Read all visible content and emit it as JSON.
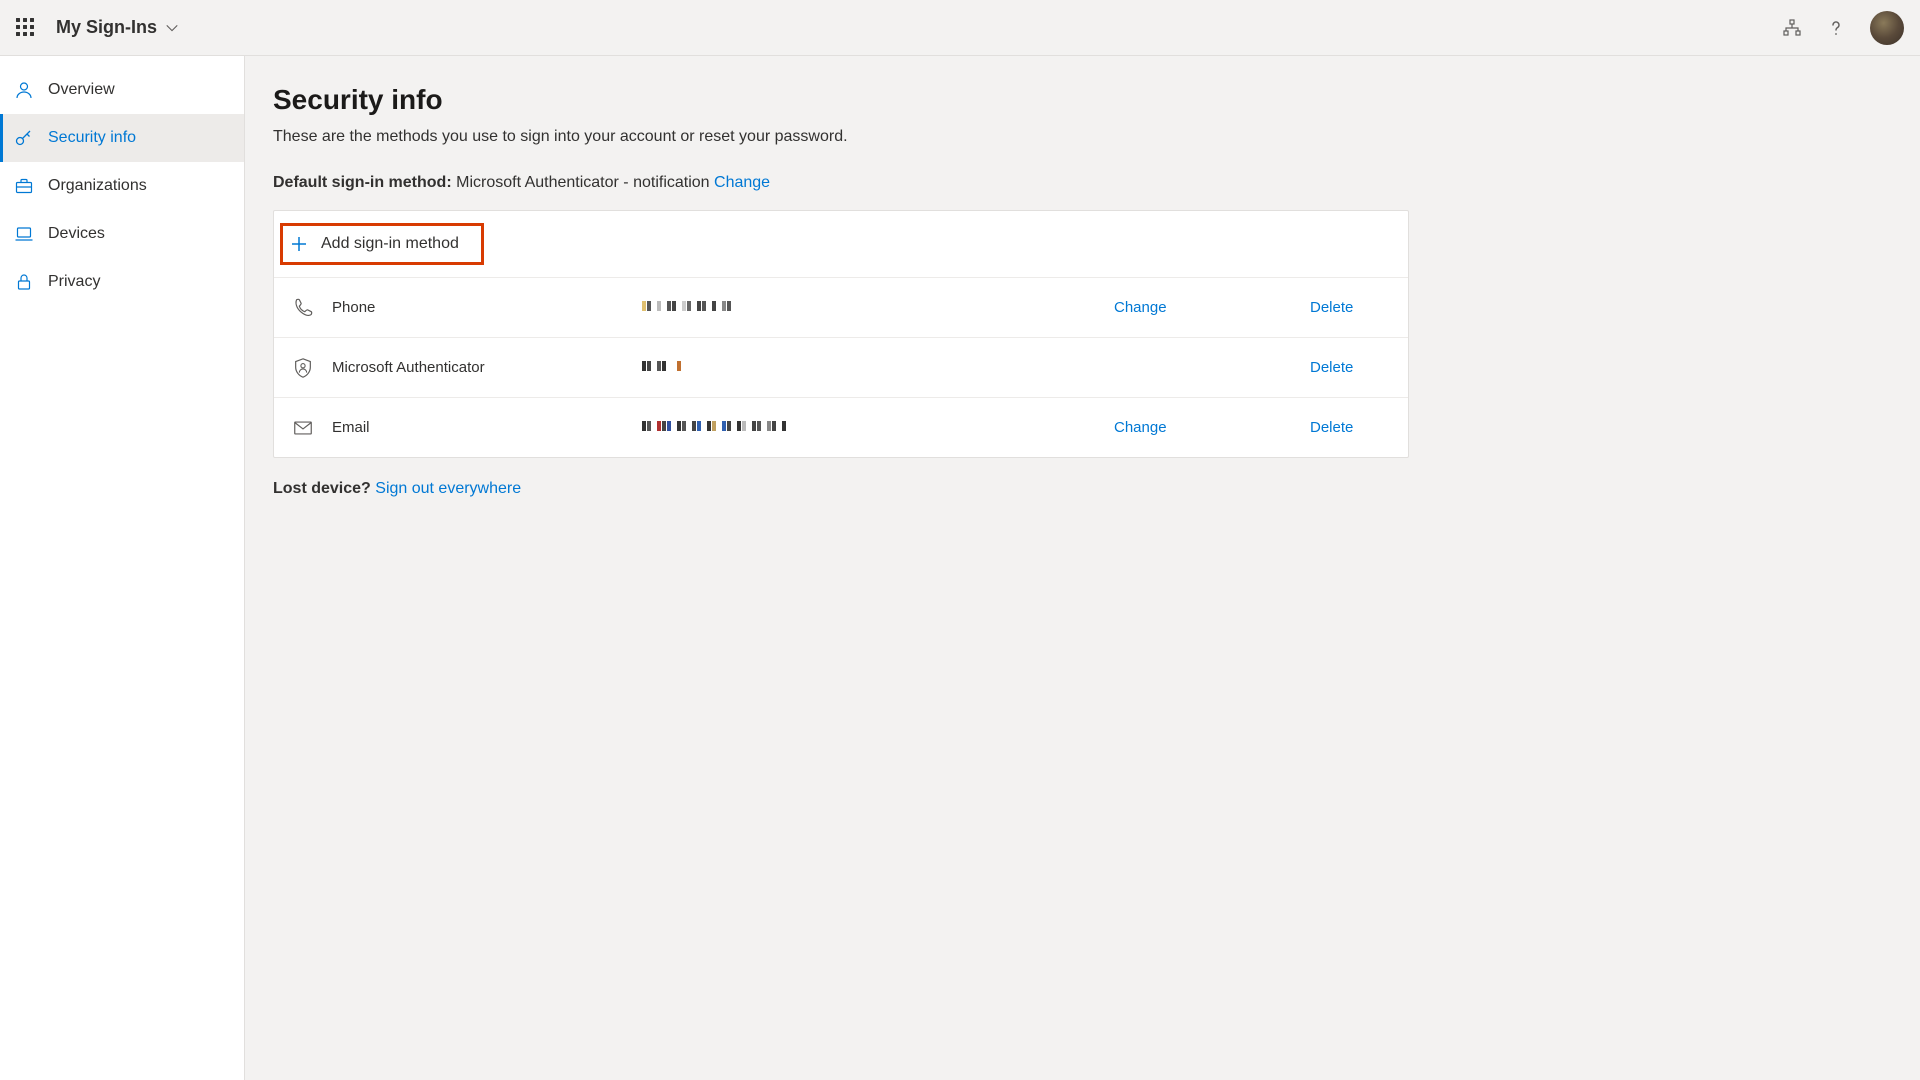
{
  "header": {
    "brand": "My Sign-Ins"
  },
  "sidebar": {
    "items": [
      {
        "label": "Overview"
      },
      {
        "label": "Security info"
      },
      {
        "label": "Organizations"
      },
      {
        "label": "Devices"
      },
      {
        "label": "Privacy"
      }
    ]
  },
  "page": {
    "title": "Security info",
    "subtitle": "These are the methods you use to sign into your account or reset your password.",
    "default_label": "Default sign-in method:",
    "default_value": "Microsoft Authenticator - notification",
    "change": "Change",
    "add_method": "Add sign-in method",
    "lost_label": "Lost device?",
    "sign_out": "Sign out everywhere"
  },
  "methods": [
    {
      "name": "Phone",
      "value_redacted": true,
      "change": "Change",
      "delete": "Delete"
    },
    {
      "name": "Microsoft Authenticator",
      "value_redacted": true,
      "change": "",
      "delete": "Delete"
    },
    {
      "name": "Email",
      "value_redacted": true,
      "change": "Change",
      "delete": "Delete"
    }
  ]
}
